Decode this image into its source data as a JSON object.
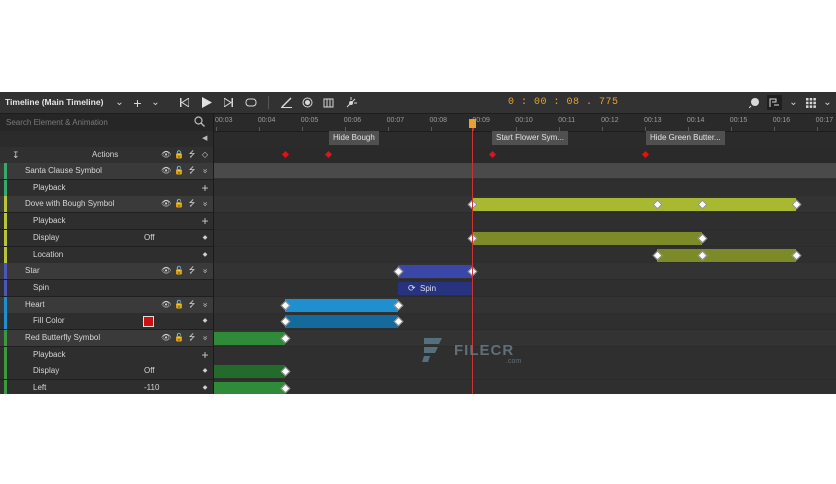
{
  "toolbar": {
    "title": "Timeline (Main Timeline)",
    "timecode": "0 : 00 : 08 . 775"
  },
  "search": {
    "placeholder": "Search Element & Animation"
  },
  "actions_row": {
    "label": "Actions"
  },
  "rows": [
    {
      "label": "Santa Clause Symbol",
      "kind": "element",
      "color": "#3aa86b"
    },
    {
      "label": "Playback",
      "kind": "sub",
      "color": "#3aa86b"
    },
    {
      "label": "Dove with Bough Symbol",
      "kind": "element",
      "color": "#b8c43a"
    },
    {
      "label": "Playback",
      "kind": "sub",
      "color": "#b8c43a"
    },
    {
      "label": "Display",
      "kind": "sub",
      "value": "Off",
      "color": "#b8c43a"
    },
    {
      "label": "Location",
      "kind": "sub",
      "color": "#b8c43a"
    },
    {
      "label": "Star",
      "kind": "element",
      "color": "#4b56b8"
    },
    {
      "label": "Spin",
      "kind": "sub",
      "color": "#4b56b8"
    },
    {
      "label": "Heart",
      "kind": "element",
      "color": "#1e90d0"
    },
    {
      "label": "Fill Color",
      "kind": "sub",
      "color": "#1e90d0",
      "swatch": "#cc1111"
    },
    {
      "label": "Red Butterfly Symbol",
      "kind": "element",
      "color": "#3c9a3c"
    },
    {
      "label": "Playback",
      "kind": "sub",
      "color": "#3c9a3c"
    },
    {
      "label": "Display",
      "kind": "sub",
      "value": "Off",
      "color": "#3c9a3c"
    },
    {
      "label": "Left",
      "kind": "sub",
      "value": "-110",
      "color": "#3c9a3c"
    }
  ],
  "ruler": [
    "00:03",
    "00:04",
    "00:05",
    "00:06",
    "00:07",
    "00:08",
    "00:09",
    "00:10",
    "00:11",
    "00:12",
    "00:13",
    "00:14",
    "00:15",
    "00:16",
    "00:17"
  ],
  "action_labels": [
    "Hide Bough",
    "Start Flower Sym...",
    "Hide Green Butter..."
  ],
  "spin_label": "Spin",
  "watermark": {
    "brand": "FILECR",
    "suffix": ".com"
  },
  "colors": {
    "accent": "#e8a030",
    "playhead": "#cc3333",
    "dove": "#a8b830",
    "dove_dark": "#7d8a28",
    "star": "#3a47a8",
    "heart": "#1e90d0",
    "heart_dark": "#156a9c",
    "butterfly": "#2f8a3a"
  }
}
